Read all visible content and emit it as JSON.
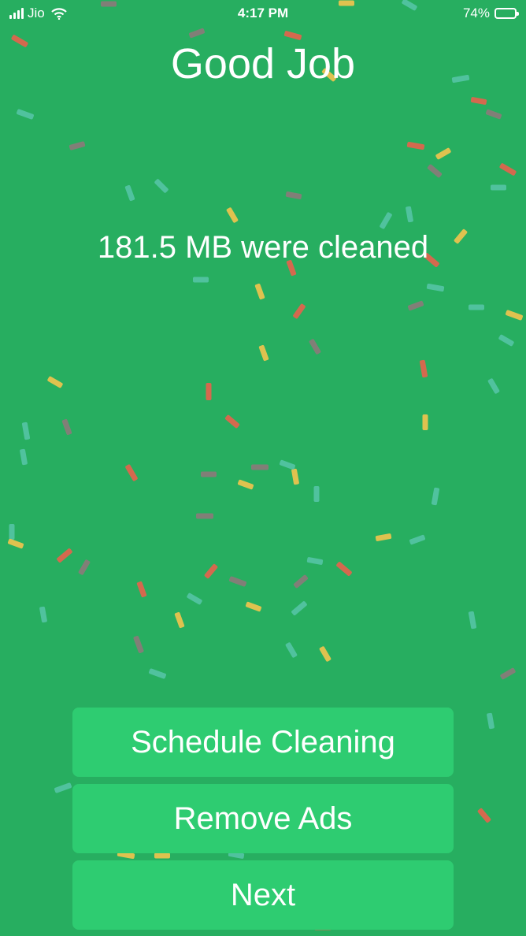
{
  "status_bar": {
    "carrier": "Jio",
    "time": "4:17 PM",
    "battery": "74%",
    "battery_level": 0.74
  },
  "title": "Good Job",
  "subtitle": "181.5 MB were cleaned",
  "buttons": {
    "schedule": "Schedule Cleaning",
    "remove_ads": "Remove Ads",
    "next": "Next"
  },
  "colors": {
    "background": "#27ae60",
    "button": "#2ecc71",
    "confetti": [
      "#e8624d",
      "#f4c44e",
      "#5fc8b3",
      "#8c7a7a"
    ]
  },
  "icons": [
    "signal-icon",
    "wifi-icon",
    "battery-icon"
  ]
}
